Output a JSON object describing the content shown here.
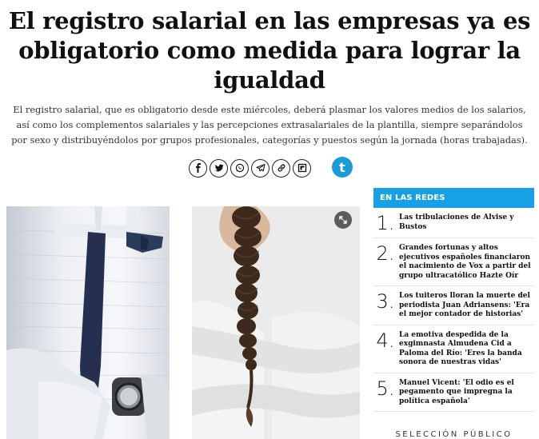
{
  "article": {
    "headline": "El registro salarial en las empresas ya es obligatorio como medida para lograr la igualdad",
    "lede": "El registro salarial, que es obligatorio desde este miércoles, deberá plasmar los valores medios de los salarios, así como los complementos salariales y las percepciones extrasalariales de la plantilla, siempre separándolos por sexo y distribuyéndolos por grupos profesionales, categorías y puestos según la jornada (horas trabajadas)."
  },
  "share": {
    "buttons": [
      {
        "icon": "facebook-icon",
        "glyph": "f"
      },
      {
        "icon": "twitter-icon"
      },
      {
        "icon": "whatsapp-icon"
      },
      {
        "icon": "telegram-icon"
      },
      {
        "icon": "link-icon"
      },
      {
        "icon": "flipboard-icon"
      }
    ],
    "brand_glyph": "t"
  },
  "sidebar": {
    "title": "EN LAS REDES",
    "items": [
      {
        "num": "1.",
        "text": "Las tribulaciones de Alvise y Bustos"
      },
      {
        "num": "2.",
        "text": "Grandes fortunas y altos ejecutivos españoles financiaron el nacimiento de Vox a partir del grupo ultracatólico Hazte Oír"
      },
      {
        "num": "3.",
        "text": "Los tuiteros lloran la muerte del periodista Juan Adriansens: 'Era el mejor contador de historias'"
      },
      {
        "num": "4.",
        "text": "La emotiva despedida de la exgimnasta Almudena Cid a Paloma del Río: 'Eres la banda sonora de nuestras vidas'"
      },
      {
        "num": "5.",
        "text": "Manuel Vicent: 'El odio es el pegamento que impregna la política española'"
      }
    ],
    "footer": "SELECCIÓN PÚBLICO"
  },
  "colors": {
    "accent": "#18a0e4",
    "text": "#111111"
  }
}
